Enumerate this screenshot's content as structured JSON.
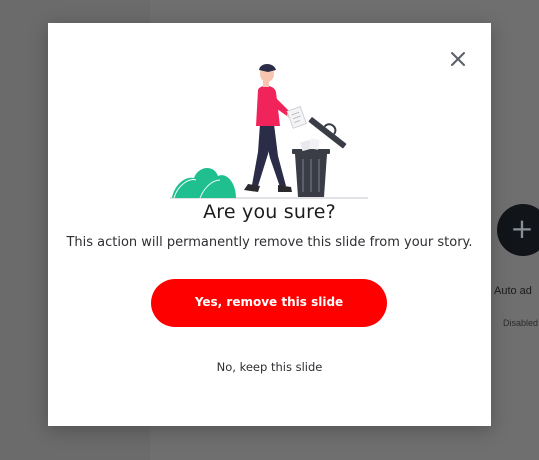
{
  "background": {
    "add_button_label": "+",
    "auto_label": "Auto ad",
    "disabled_label": "Disabled"
  },
  "dialog": {
    "title": "Are you sure?",
    "message": "This action will permanently remove this slide from your story.",
    "confirm_label": "Yes, remove this slide",
    "cancel_label": "No, keep this slide",
    "close_icon": "close-icon",
    "illustration": "person-throwing-paper-in-trash-illustration"
  },
  "colors": {
    "confirm_button": "#ff0000",
    "overlay": "#6f6f6f",
    "person_shirt": "#f0245a",
    "plant": "#1fbf8f",
    "trash_can": "#3a3d46"
  }
}
